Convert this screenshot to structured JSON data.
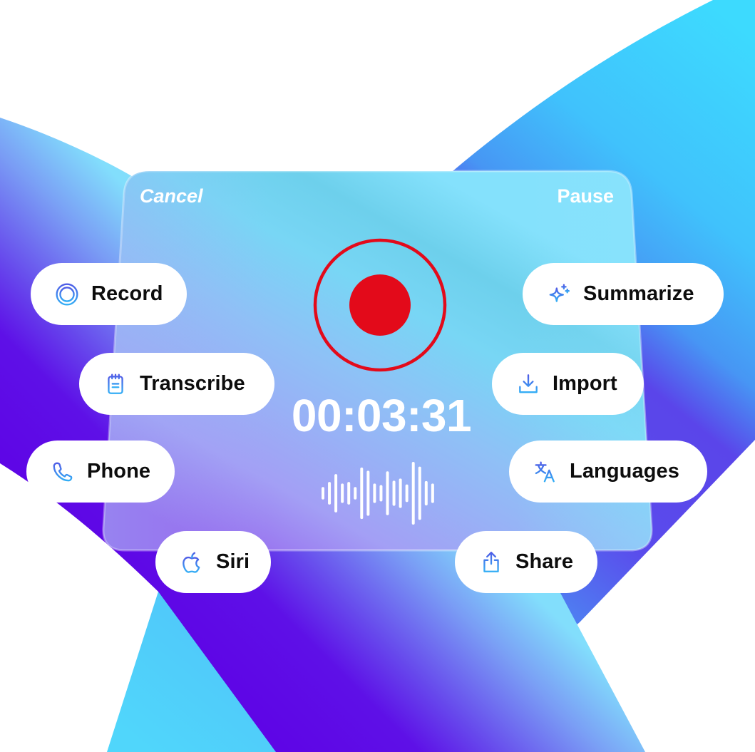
{
  "controls": {
    "cancel_label": "Cancel",
    "pause_label": "Pause"
  },
  "recorder": {
    "state": "recording",
    "elapsed_time": "00:03:31",
    "waveform_levels": [
      0.2,
      0.36,
      0.61,
      0.31,
      0.36,
      0.2,
      0.82,
      0.72,
      0.31,
      0.26,
      0.7,
      0.4,
      0.47,
      0.28,
      1.0,
      0.85,
      0.39,
      0.31
    ]
  },
  "actions": {
    "left": [
      {
        "label": "Record",
        "icon": "record-icon"
      },
      {
        "label": "Transcribe",
        "icon": "notepad-icon"
      },
      {
        "label": "Phone",
        "icon": "phone-icon"
      },
      {
        "label": "Siri",
        "icon": "apple-icon"
      }
    ],
    "right": [
      {
        "label": "Summarize",
        "icon": "sparkles-icon"
      },
      {
        "label": "Import",
        "icon": "download-icon"
      },
      {
        "label": "Languages",
        "icon": "translate-icon"
      },
      {
        "label": "Share",
        "icon": "share-icon"
      }
    ]
  },
  "colors": {
    "record_red": "#E30A1A",
    "label_text": "#0D0D0D",
    "icon_gradient_start": "#4F5CE6",
    "icon_gradient_end": "#34AEF5",
    "ribbon_violet": "#5E05E6",
    "ribbon_cyan": "#3DDAFE"
  }
}
